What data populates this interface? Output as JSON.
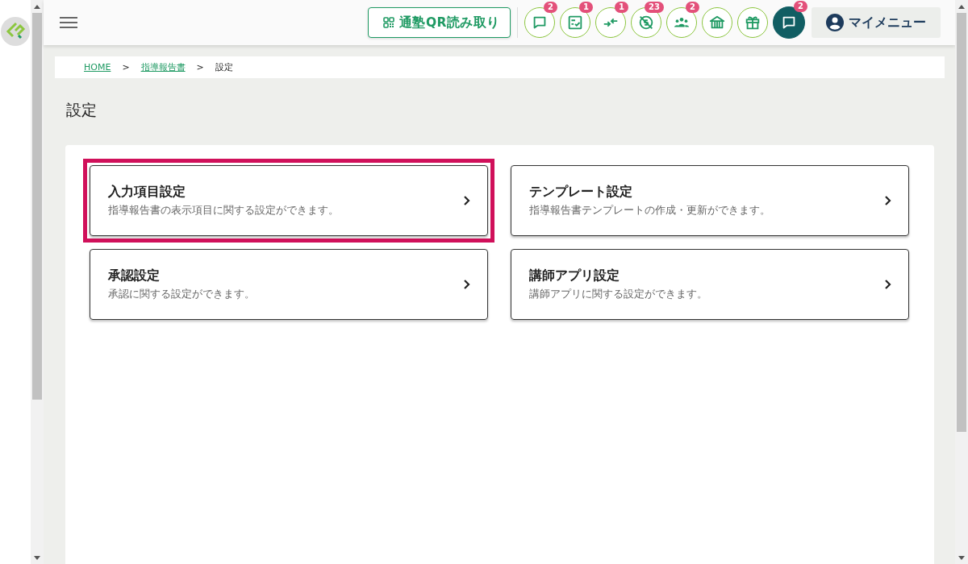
{
  "header": {
    "qr_button": "通塾QR読み取り",
    "icon_buttons": [
      {
        "badge": "2",
        "kind": "outline"
      },
      {
        "badge": "1",
        "kind": "outline"
      },
      {
        "badge": "1",
        "kind": "outline"
      },
      {
        "badge": "23",
        "kind": "outline"
      },
      {
        "badge": "2",
        "kind": "outline"
      },
      {
        "kind": "outline"
      },
      {
        "kind": "outline"
      },
      {
        "badge": "2",
        "kind": "filled"
      }
    ],
    "my_menu": "マイメニュー"
  },
  "breadcrumb": [
    {
      "label": "HOME",
      "link": true
    },
    {
      "label": "指導報告書",
      "link": true
    },
    {
      "label": "設定",
      "link": false
    }
  ],
  "breadcrumb_separator": ">",
  "page_title": "設定",
  "settings": [
    {
      "title": "入力項目設定",
      "description": "指導報告書の表示項目に関する設定ができます。",
      "highlighted": true
    },
    {
      "title": "テンプレート設定",
      "description": "指導報告書テンプレートの作成・更新ができます。",
      "highlighted": false
    },
    {
      "title": "承認設定",
      "description": "承認に関する設定ができます。",
      "highlighted": false
    },
    {
      "title": "講師アプリ設定",
      "description": "講師アプリに関する設定ができます。",
      "highlighted": false
    }
  ]
}
